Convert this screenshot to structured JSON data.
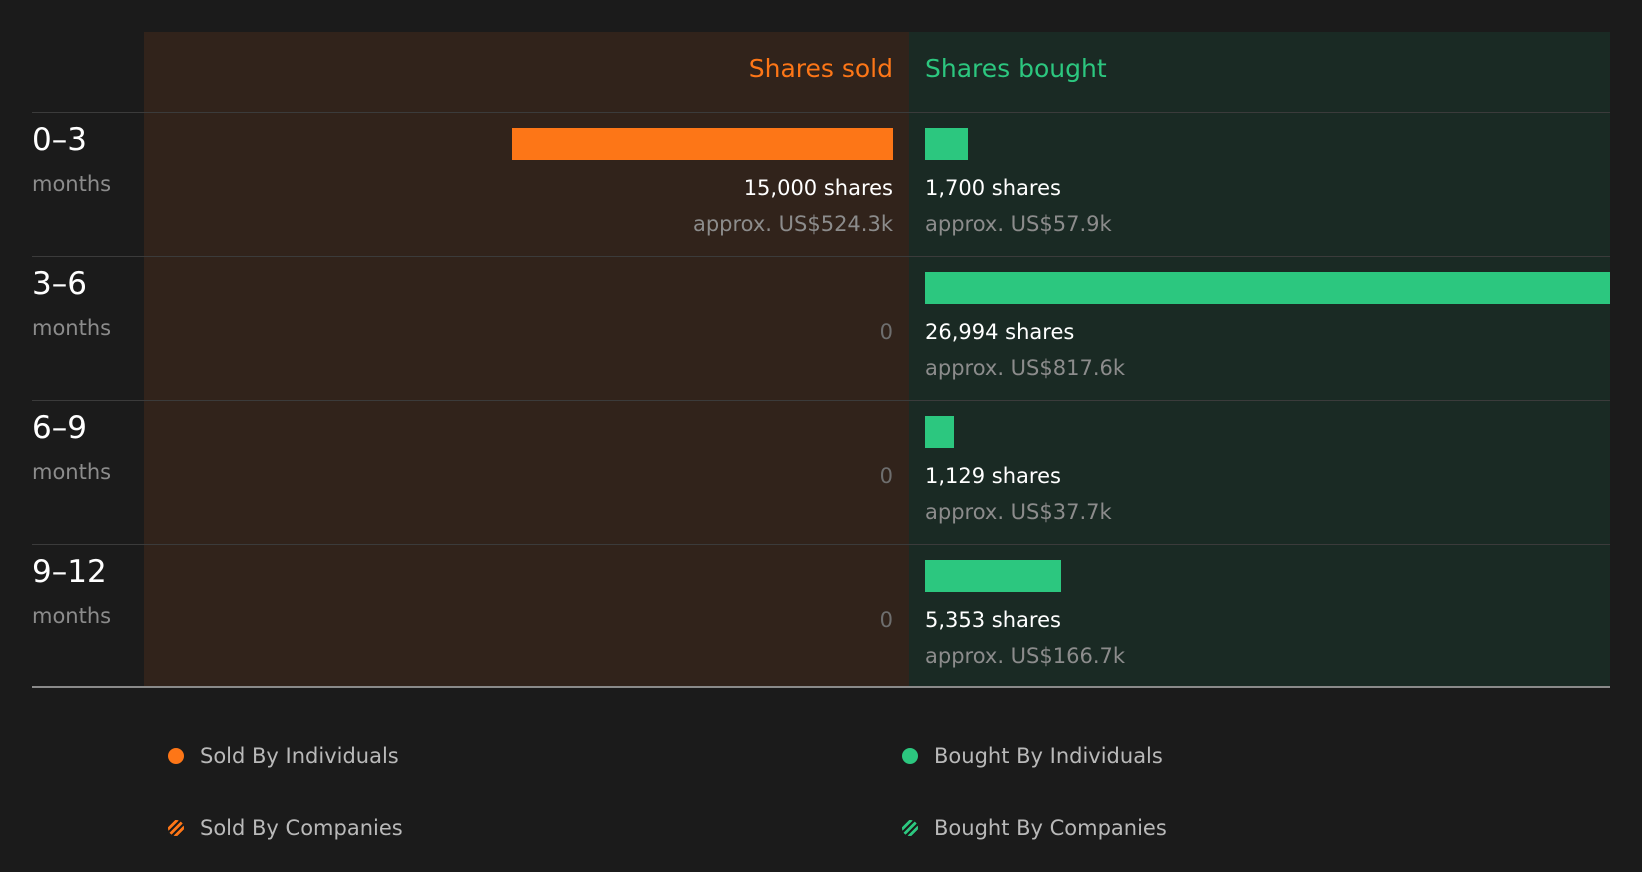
{
  "colors": {
    "sold": "#fd7617",
    "bought": "#2cc77f",
    "sold_panel": "#31231b",
    "bought_panel": "#1a2a24",
    "value_text": "#ffffff",
    "approx_text": "#8c8c8c",
    "zero_text": "#6e6e6e",
    "label_sub": "#8c8c8c"
  },
  "header": {
    "sold_label": "Shares sold",
    "bought_label": "Shares bought"
  },
  "chart_data": {
    "type": "bar",
    "categories": [
      "0–3",
      "3–6",
      "6–9",
      "9–12"
    ],
    "category_unit": "months",
    "series": [
      {
        "name": "Shares sold",
        "values": [
          15000,
          0,
          0,
          0
        ],
        "labels": [
          "15,000 shares",
          "0",
          "0",
          "0"
        ],
        "approx": [
          "approx. US$524.3k",
          "",
          "",
          ""
        ]
      },
      {
        "name": "Shares bought",
        "values": [
          1700,
          26994,
          1129,
          5353
        ],
        "labels": [
          "1,700 shares",
          "26,994 shares",
          "1,129 shares",
          "5,353 shares"
        ],
        "approx": [
          "approx. US$57.9k",
          "approx. US$817.6k",
          "approx. US$37.7k",
          "approx. US$166.7k"
        ]
      }
    ],
    "xlim": [
      0,
      26994
    ]
  },
  "legend": [
    {
      "label": "Sold By Individuals",
      "icon": "orange-dot-icon"
    },
    {
      "label": "Bought By Individuals",
      "icon": "green-dot-icon"
    },
    {
      "label": "Sold By Companies",
      "icon": "orange-hatched-dot-icon"
    },
    {
      "label": "Bought By Companies",
      "icon": "green-hatched-dot-icon"
    }
  ]
}
